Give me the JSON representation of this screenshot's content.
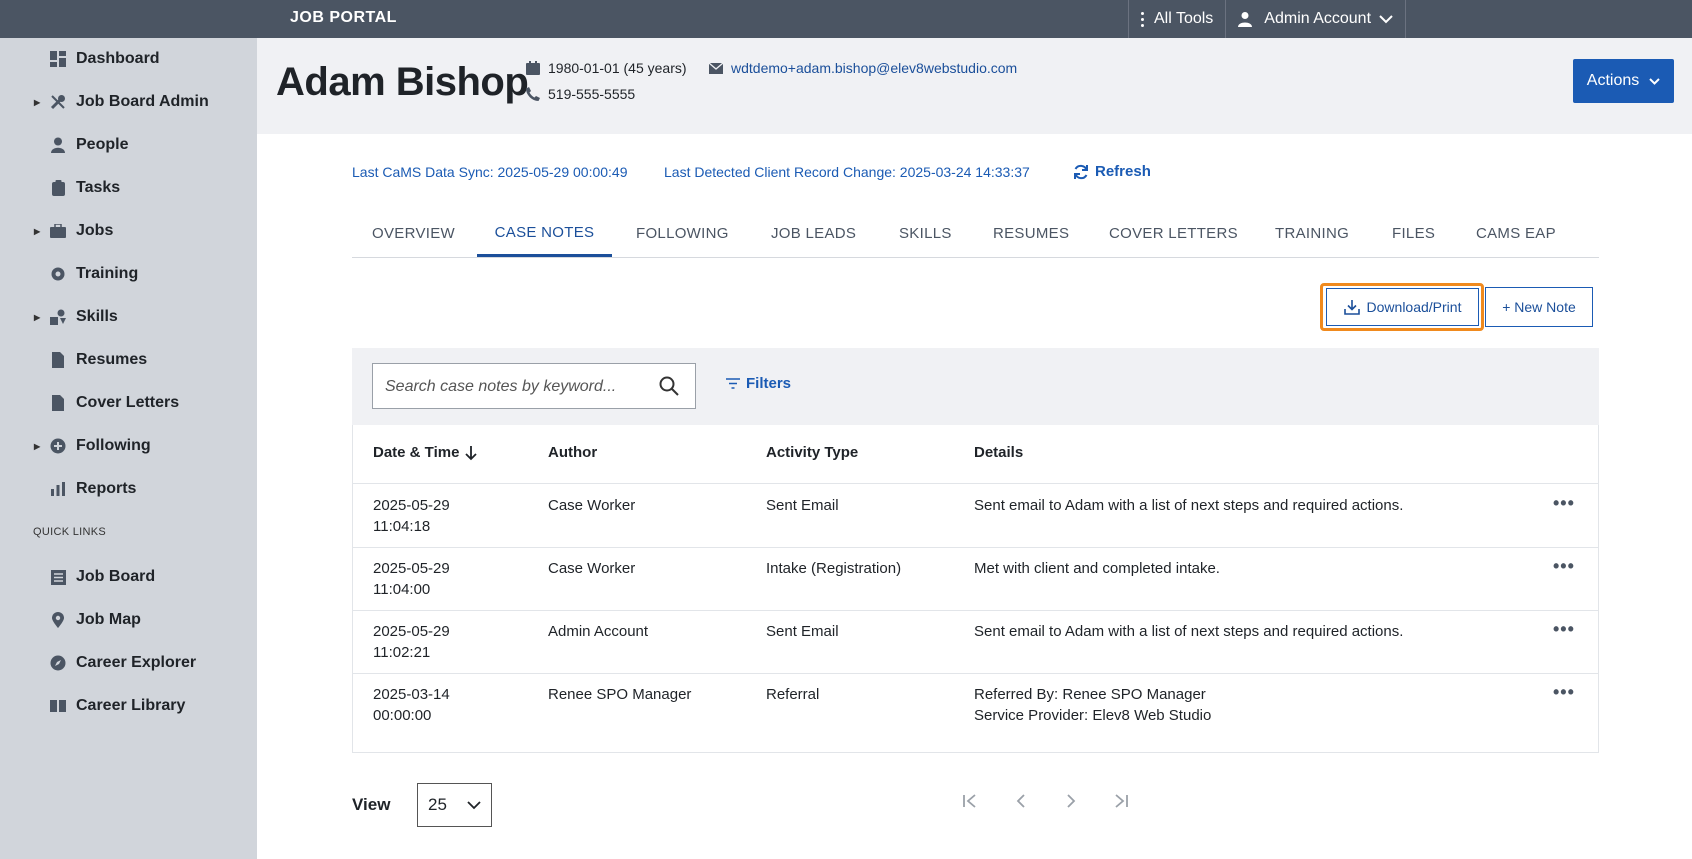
{
  "topbar": {
    "brand": "JOB PORTAL",
    "all_tools": "All Tools",
    "account": "Admin Account"
  },
  "sidebar": {
    "items": [
      {
        "label": "Dashboard",
        "icon": "dashboard-icon"
      },
      {
        "label": "Job Board Admin",
        "icon": "tools-icon"
      },
      {
        "label": "People",
        "icon": "person-icon"
      },
      {
        "label": "Tasks",
        "icon": "clipboard-icon"
      },
      {
        "label": "Jobs",
        "icon": "briefcase-icon"
      },
      {
        "label": "Training",
        "icon": "gear-icon"
      },
      {
        "label": "Skills",
        "icon": "skills-icon"
      },
      {
        "label": "Resumes",
        "icon": "document-icon"
      },
      {
        "label": "Cover Letters",
        "icon": "document-icon"
      },
      {
        "label": "Following",
        "icon": "plus-circle-icon"
      },
      {
        "label": "Reports",
        "icon": "bar-chart-icon"
      }
    ],
    "quick_links_label": "QUICK LINKS",
    "quick_links": [
      {
        "label": "Job Board",
        "icon": "list-icon"
      },
      {
        "label": "Job Map",
        "icon": "map-pin-icon"
      },
      {
        "label": "Career Explorer",
        "icon": "compass-icon"
      },
      {
        "label": "Career Library",
        "icon": "book-icon"
      }
    ]
  },
  "person": {
    "name": "Adam Bishop",
    "dob": "1980-01-01 (45 years)",
    "phone": "519-555-5555",
    "email": "wdtdemo+adam.bishop@elev8webstudio.com"
  },
  "actions_label": "Actions",
  "sync": {
    "cams": "Last CaMS Data Sync: 2025-05-29 00:00:49",
    "record_change": "Last Detected Client Record Change: 2025-03-24 14:33:37",
    "refresh": "Refresh"
  },
  "tabs": [
    "OVERVIEW",
    "CASE NOTES",
    "FOLLOWING",
    "JOB LEADS",
    "SKILLS",
    "RESUMES",
    "COVER LETTERS",
    "TRAINING",
    "FILES",
    "CAMS EAP"
  ],
  "active_tab": "CASE NOTES",
  "buttons": {
    "download": "Download/Print",
    "new_note": "+ New Note"
  },
  "search": {
    "placeholder": "Search case notes by keyword...",
    "filters": "Filters"
  },
  "table": {
    "headers": [
      "Date & Time",
      "Author",
      "Activity Type",
      "Details"
    ],
    "rows": [
      {
        "date": "2025-05-29",
        "time": "11:04:18",
        "author": "Case Worker",
        "type": "Sent Email",
        "details1": "Sent email to Adam with a list of next steps and required actions.",
        "details2": ""
      },
      {
        "date": "2025-05-29",
        "time": "11:04:00",
        "author": "Case Worker",
        "type": "Intake (Registration)",
        "details1": "Met with client and completed intake.",
        "details2": ""
      },
      {
        "date": "2025-05-29",
        "time": "11:02:21",
        "author": "Admin Account",
        "type": "Sent Email",
        "details1": "Sent email to Adam with a list of next steps and required actions.",
        "details2": ""
      },
      {
        "date": "2025-03-14",
        "time": "00:00:00",
        "author": "Renee SPO Manager",
        "type": "Referral",
        "details1": "Referred By: Renee SPO Manager",
        "details2": "Service Provider: Elev8 Web Studio"
      }
    ]
  },
  "footer": {
    "view_label": "View",
    "page_size": "25"
  },
  "colors": {
    "topbar": "#4b5563",
    "sidebar": "#d1d5db",
    "accent": "#1b5bb4",
    "highlight": "#f08a1e"
  }
}
